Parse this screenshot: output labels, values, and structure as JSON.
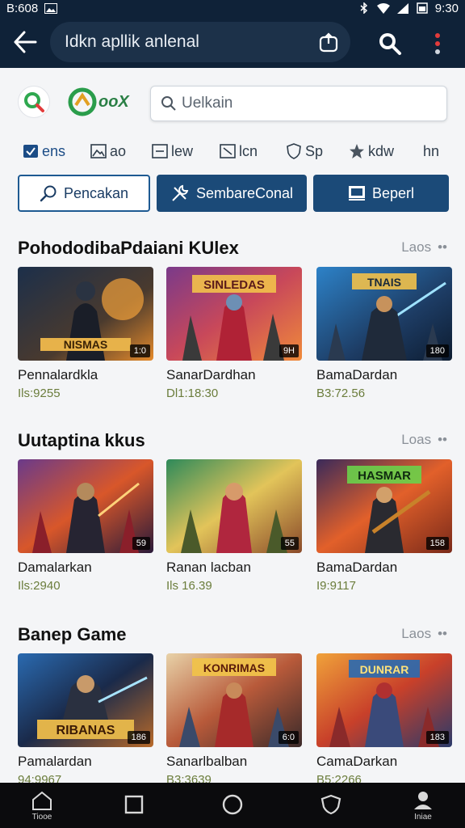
{
  "status_bar": {
    "time_left": "B:608",
    "time_right": "9:30"
  },
  "top_bar": {
    "url_text": "Idkn apllik anlenal"
  },
  "search": {
    "placeholder": "Uelkain"
  },
  "logo": {
    "brand_text": "ooX"
  },
  "filters": [
    {
      "label": "ens",
      "icon": "checkbox-icon"
    },
    {
      "label": "ao",
      "icon": "image-icon"
    },
    {
      "label": "lew",
      "icon": "square-icon"
    },
    {
      "label": "lcn",
      "icon": "edit-icon"
    },
    {
      "label": "Sp",
      "icon": "shield-icon"
    },
    {
      "label": "kdw",
      "icon": "star-icon"
    },
    {
      "label": "hn",
      "icon": ""
    }
  ],
  "actions": [
    {
      "label": "Pencakan",
      "icon": "search-icon"
    },
    {
      "label": "SembareConal",
      "icon": "tools-icon"
    },
    {
      "label": "Beperl",
      "icon": "monitor-icon"
    }
  ],
  "sections": [
    {
      "title": "PohododibaPdaiani KUlex",
      "more": "Laos",
      "cards": [
        {
          "title": "Pennalardkla",
          "meta": "Ils:9255",
          "badge": "1:0",
          "banner": "NISMAS"
        },
        {
          "title": "SanarDardhan",
          "meta": "Dl1:18:30",
          "badge": "9H",
          "banner": "SINLEDAS"
        },
        {
          "title": "BamaDardan",
          "meta": "B3:72.56",
          "badge": "180",
          "banner": "TNAIS"
        }
      ]
    },
    {
      "title": "Uutaptina kkus",
      "more": "Loas",
      "cards": [
        {
          "title": "Damalarkan",
          "meta": "Ils:2940",
          "badge": "59",
          "banner": ""
        },
        {
          "title": "Ranan lacban",
          "meta": "Ils 16.39",
          "badge": "55",
          "banner": ""
        },
        {
          "title": "BamaDardan",
          "meta": "I9:9117",
          "badge": "158",
          "banner": "HASMAR"
        }
      ]
    },
    {
      "title": "Banep Game",
      "more": "Laos",
      "cards": [
        {
          "title": "Pamalardan",
          "meta": "94:9967",
          "badge": "186",
          "banner": "RIBANAS"
        },
        {
          "title": "Sanarlbalban",
          "meta": "B3:3639",
          "badge": "6:0",
          "banner": "KONRIMAS"
        },
        {
          "title": "CamaDarkan",
          "meta": "B5:2266",
          "badge": "183",
          "banner": "DUNRAR"
        }
      ]
    }
  ],
  "bottom_nav": {
    "home": "Tiooe",
    "profile": "Iniae"
  },
  "colors": {
    "top_bar": "#0f2238",
    "accent": "#1b4a78",
    "meta_text": "#6b7d3c"
  }
}
